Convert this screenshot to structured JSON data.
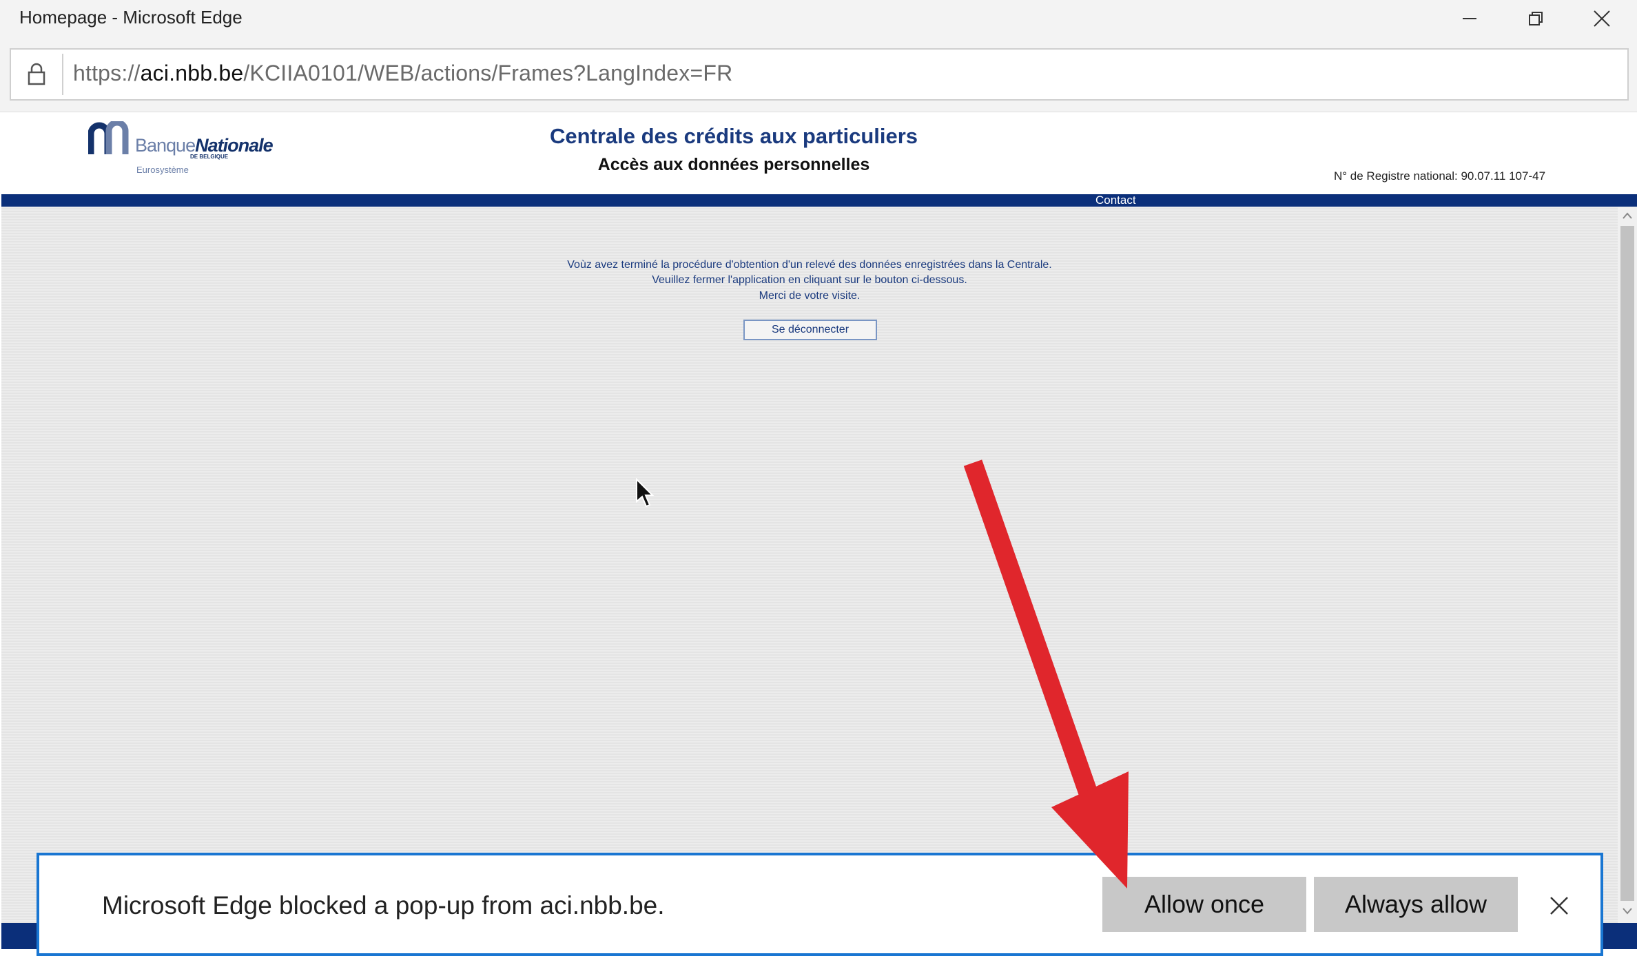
{
  "window": {
    "title": "Homepage - Microsoft Edge",
    "controls": [
      "minimize-icon",
      "restore-icon",
      "close-icon"
    ]
  },
  "address_bar": {
    "scheme": "https://",
    "host": "aci.nbb.be",
    "path": "/KCIIA0101/WEB/actions/Frames?LangIndex=FR",
    "icon": "lock-icon"
  },
  "page": {
    "logo": {
      "name_light": "Banque",
      "name_bold": "Nationale",
      "sub": "DE BELGIQUE",
      "eurosystem": "Eurosystème"
    },
    "title": "Centrale des crédits aux particuliers",
    "subtitle": "Accès aux données personnelles",
    "registre": "N° de Registre national: 90.07.11 107-47",
    "nav_contact": "Contact",
    "message": {
      "line1": "Voùz avez terminé la procédure d'obtention d'un relevé des données enregistrées dans la Centrale.",
      "line2": "Veuillez fermer l'application en cliquant sur le bouton ci-dessous.",
      "line3": "Merci de votre visite."
    },
    "logout_label": "Se déconnecter"
  },
  "popup_bar": {
    "message": "Microsoft Edge blocked a pop-up from aci.nbb.be.",
    "allow_once": "Allow once",
    "always_allow": "Always allow",
    "close_icon": "close-icon"
  },
  "colors": {
    "brand_navy": "#0b2f7a",
    "title_blue": "#1a3a7e",
    "popup_border": "#1976d2",
    "annotation_arrow": "#e0262c"
  }
}
